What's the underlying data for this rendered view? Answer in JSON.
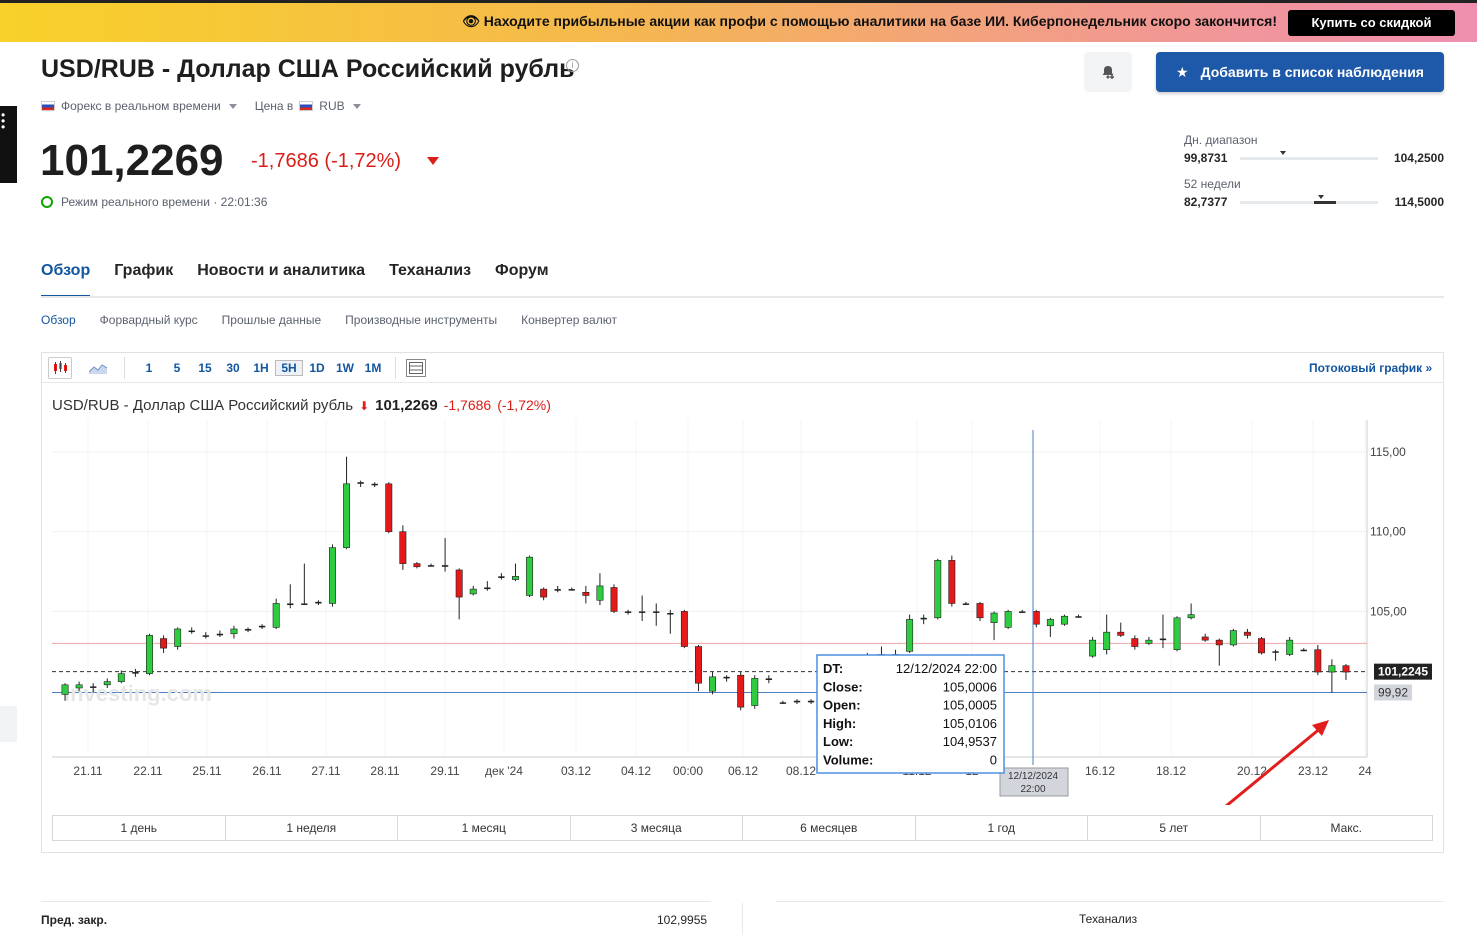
{
  "promo": {
    "text": "👁 Находите прибыльные акции как профи с помощью аналитики на базе ИИ. Киберпонедельник скоро закончится!",
    "button": "Купить со скидкой"
  },
  "header": {
    "title": "USD/RUB - Доллар США Российский рубль",
    "market": "Форекс в реальном времени",
    "price_in": "Цена в",
    "currency": "RUB",
    "price": "101,2269",
    "change": "-1,7686",
    "change_pct": "(-1,72%)",
    "realtime": "Режим реального времени · 22:01:36",
    "watch_button": "Добавить в список наблюдения"
  },
  "ranges": {
    "day_label": "Дн. диапазон",
    "day_low": "99,8731",
    "day_high": "104,2500",
    "day_pos": 0.31,
    "week52_label": "52 недели",
    "week52_low": "82,7377",
    "week52_high": "114,5000",
    "week52_pos": 0.59
  },
  "tabs": [
    "Обзор",
    "График",
    "Новости и аналитика",
    "Теханализ",
    "Форум"
  ],
  "subtabs": [
    "Обзор",
    "Форвардный курс",
    "Прошлые данные",
    "Производные инструменты",
    "Конвертер валют"
  ],
  "toolbar": {
    "intervals": [
      "1",
      "5",
      "15",
      "30",
      "1H",
      "5H",
      "1D",
      "1W",
      "1M"
    ],
    "selected": "5H",
    "streaming": "Потоковый график »"
  },
  "chart_head": {
    "name": "USD/RUB - Доллар США Российский рубль",
    "price": "101,2269",
    "change": "-1,7686",
    "change_pct": "(-1,72%)"
  },
  "watermark": "Investing.com",
  "tooltip": {
    "dt_label": "DT:",
    "dt": "12/12/2024 22:00",
    "close_label": "Close:",
    "close": "105,0006",
    "open_label": "Open:",
    "open": "105,0005",
    "high_label": "High:",
    "high": "105,0106",
    "low_label": "Low:",
    "low": "104,9537",
    "volume_label": "Volume:",
    "volume": "0",
    "crosshair_date": "12/12/2024",
    "crosshair_time": "22:00"
  },
  "price_labels": {
    "current": "101,2245",
    "crosshair": "99,92"
  },
  "chart_data": {
    "type": "candlestick",
    "ylim": [
      96,
      117
    ],
    "yticks": [
      "115,00",
      "110,00",
      "105,00"
    ],
    "ytick_values": [
      115,
      110,
      105
    ],
    "xticks": [
      "21.11",
      "22.11",
      "25.11",
      "26.11",
      "27.11",
      "28.11",
      "29.11",
      "дек '24",
      "03.12",
      "04.12",
      "00:00",
      "06.12",
      "08.12",
      "11.12",
      "12",
      "16.12",
      "18.12",
      "20.12",
      "23.12",
      "24"
    ],
    "reference_lines": {
      "previous_close": 102.9955,
      "current": 101.2245,
      "crosshair": 99.92
    },
    "candles": [
      [
        99.8,
        100.4,
        99.4,
        100.5
      ],
      [
        100.2,
        100.4,
        100.0,
        100.6
      ],
      [
        100.3,
        100.3,
        99.9,
        100.5
      ],
      [
        100.4,
        100.6,
        100.2,
        100.8
      ],
      [
        100.6,
        101.1,
        100.5,
        101.3
      ],
      [
        101.1,
        101.2,
        100.9,
        101.4
      ],
      [
        101.1,
        103.5,
        101.0,
        103.6
      ],
      [
        103.3,
        102.7,
        102.4,
        103.5
      ],
      [
        102.8,
        103.9,
        102.6,
        104.0
      ],
      [
        103.8,
        103.8,
        103.6,
        104.0
      ],
      [
        103.5,
        103.5,
        103.3,
        103.7
      ],
      [
        103.5,
        103.6,
        103.4,
        103.8
      ],
      [
        103.6,
        103.9,
        103.3,
        104.1
      ],
      [
        103.8,
        103.9,
        103.7,
        104.0
      ],
      [
        104.1,
        104.0,
        103.9,
        104.2
      ],
      [
        104.0,
        105.5,
        103.9,
        105.8
      ],
      [
        105.4,
        105.5,
        105.2,
        106.7
      ],
      [
        105.5,
        105.5,
        105.4,
        108.0
      ],
      [
        105.5,
        105.6,
        105.4,
        105.7
      ],
      [
        105.5,
        109.0,
        105.3,
        109.2
      ],
      [
        109.0,
        113.0,
        108.9,
        114.7
      ],
      [
        113.0,
        113.1,
        112.8,
        113.2
      ],
      [
        113.0,
        113.0,
        112.8,
        113.1
      ],
      [
        113.0,
        110.0,
        109.9,
        113.1
      ],
      [
        110.0,
        108.0,
        107.6,
        110.4
      ],
      [
        108.0,
        107.8,
        107.7,
        108.1
      ],
      [
        107.9,
        107.9,
        107.8,
        108.0
      ],
      [
        107.9,
        107.8,
        107.5,
        109.6
      ],
      [
        107.6,
        105.9,
        104.5,
        107.7
      ],
      [
        106.1,
        106.4,
        106.0,
        106.6
      ],
      [
        106.4,
        106.5,
        106.3,
        106.9
      ],
      [
        107.2,
        107.1,
        107.0,
        107.4
      ],
      [
        107.0,
        107.2,
        106.9,
        108.0
      ],
      [
        106.0,
        108.4,
        105.9,
        108.5
      ],
      [
        106.4,
        105.9,
        105.7,
        106.5
      ],
      [
        106.3,
        106.4,
        106.2,
        106.6
      ],
      [
        106.4,
        106.4,
        106.3,
        106.5
      ],
      [
        106.2,
        106.0,
        105.5,
        106.6
      ],
      [
        105.7,
        106.6,
        105.4,
        107.4
      ],
      [
        106.5,
        105.0,
        104.9,
        106.7
      ],
      [
        105.0,
        105.0,
        104.8,
        105.1
      ],
      [
        105.0,
        105.0,
        104.4,
        106.0
      ],
      [
        105.0,
        105.0,
        104.1,
        105.5
      ],
      [
        104.9,
        104.9,
        103.6,
        105.1
      ],
      [
        105.0,
        102.8,
        102.7,
        105.1
      ],
      [
        102.8,
        100.5,
        100.0,
        102.9
      ],
      [
        100.0,
        100.9,
        99.8,
        101.2
      ],
      [
        100.9,
        100.8,
        100.6,
        101.0
      ],
      [
        101.0,
        99.0,
        98.8,
        101.2
      ],
      [
        99.1,
        100.8,
        98.9,
        101.0
      ],
      [
        100.7,
        100.8,
        100.5,
        101.0
      ],
      [
        99.3,
        99.3,
        99.2,
        99.4
      ],
      [
        99.3,
        99.4,
        99.2,
        99.5
      ],
      [
        99.3,
        99.4,
        99.2,
        99.5
      ],
      [
        99.3,
        99.4,
        99.2,
        99.5
      ],
      [
        99.5,
        99.6,
        99.4,
        99.8
      ],
      [
        100.2,
        100.4,
        100.0,
        100.6
      ],
      [
        101.0,
        102.2,
        100.8,
        102.4
      ],
      [
        102.0,
        102.3,
        101.8,
        102.8
      ],
      [
        102.0,
        102.3,
        101.9,
        102.6
      ],
      [
        102.5,
        104.5,
        102.4,
        104.8
      ],
      [
        104.5,
        104.6,
        104.2,
        104.8
      ],
      [
        104.6,
        108.2,
        104.5,
        108.3
      ],
      [
        108.2,
        105.5,
        105.3,
        108.5
      ],
      [
        105.5,
        105.5,
        105.4,
        105.6
      ],
      [
        105.5,
        104.6,
        104.4,
        105.6
      ],
      [
        104.3,
        104.9,
        103.2,
        105.0
      ],
      [
        104.0,
        105.0,
        103.9,
        105.1
      ],
      [
        105.0,
        105.0,
        104.9,
        105.1
      ],
      [
        105.0,
        104.2,
        104.0,
        105.1
      ],
      [
        104.1,
        104.5,
        103.4,
        104.6
      ],
      [
        104.2,
        104.7,
        104.1,
        104.8
      ],
      [
        104.7,
        104.7,
        104.6,
        104.8
      ],
      [
        102.2,
        103.2,
        102.1,
        103.4
      ],
      [
        102.6,
        103.7,
        102.3,
        104.8
      ],
      [
        103.7,
        103.5,
        103.4,
        104.3
      ],
      [
        103.3,
        102.8,
        102.6,
        103.5
      ],
      [
        103.0,
        103.2,
        102.9,
        103.4
      ],
      [
        103.3,
        103.2,
        102.7,
        104.8
      ],
      [
        102.6,
        104.6,
        102.5,
        104.7
      ],
      [
        104.6,
        104.8,
        104.5,
        105.5
      ],
      [
        103.4,
        103.2,
        103.1,
        103.6
      ],
      [
        103.2,
        102.9,
        101.6,
        103.3
      ],
      [
        102.9,
        103.8,
        102.8,
        103.9
      ],
      [
        103.7,
        103.5,
        103.3,
        103.9
      ],
      [
        103.3,
        102.4,
        102.3,
        103.4
      ],
      [
        102.5,
        102.5,
        101.9,
        102.6
      ],
      [
        102.3,
        103.2,
        102.2,
        103.4
      ],
      [
        102.6,
        102.6,
        102.5,
        102.7
      ],
      [
        102.6,
        101.2,
        101.0,
        102.9
      ],
      [
        101.2,
        101.6,
        99.9,
        102.0
      ],
      [
        101.6,
        101.2,
        100.7,
        101.7
      ]
    ]
  },
  "periods": [
    "1 день",
    "1 неделя",
    "1 месяц",
    "3 месяца",
    "6 месяцев",
    "1 год",
    "5 лет",
    "Макс."
  ],
  "bottom": {
    "prev_close_label": "Пред. закр.",
    "prev_close": "102,9955",
    "technical": "Теханализ"
  },
  "colors": {
    "up": "#2ecc40",
    "down": "#e3191a",
    "accent": "#1256a0",
    "annotation_arrow": "#e11d1d"
  }
}
